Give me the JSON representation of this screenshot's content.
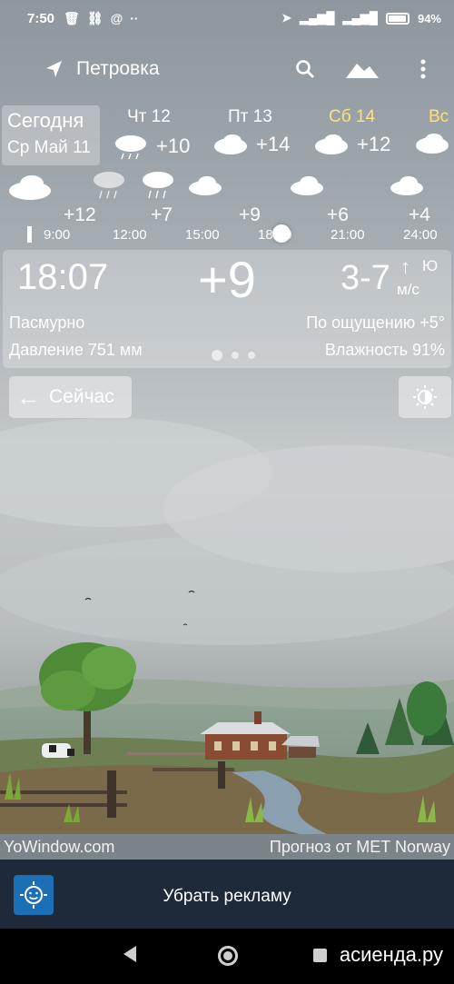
{
  "status_bar": {
    "time": "7:50",
    "battery": "94%",
    "battery_level": 0.94
  },
  "header": {
    "location": "Петровка",
    "icons": [
      "location-arrow-icon",
      "search-icon",
      "landscape-icon",
      "more-vertical-icon"
    ]
  },
  "daily": {
    "today_label": "Сегодня",
    "today_date": "Ср Май 11",
    "days": [
      {
        "name": "Чт 12",
        "temp": "+10",
        "icon": "rain-cloud-icon",
        "weekend": false
      },
      {
        "name": "Пт 13",
        "temp": "+14",
        "icon": "cloud-icon",
        "weekend": false
      },
      {
        "name": "Сб 14",
        "temp": "+12",
        "icon": "cloud-icon",
        "weekend": true
      },
      {
        "name": "Вс",
        "temp": "",
        "icon": "cloud-icon",
        "weekend": true
      }
    ]
  },
  "hourly": {
    "temps": [
      "+12",
      "+7",
      "+9",
      "+6",
      "+4"
    ],
    "times": [
      "9:00",
      "12:00",
      "15:00",
      "18:00",
      "21:00",
      "24:00"
    ]
  },
  "current": {
    "time": "18:07",
    "temp": "+9",
    "wind_speed": "3-7",
    "wind_arrow": "↑",
    "wind_dir": "Ю",
    "wind_unit": "м/с",
    "condition": "Пасмурно",
    "feels_like": "По ощущению +5°",
    "pressure": "Давление 751 мм",
    "humidity": "Влажность 91%"
  },
  "buttons": {
    "now": "Сейчас"
  },
  "credits": {
    "left": "YoWindow.com",
    "right": "Прогноз от MET Norway"
  },
  "ad": {
    "label": "Убрать рекламу"
  },
  "watermark": "асиенда.ру"
}
